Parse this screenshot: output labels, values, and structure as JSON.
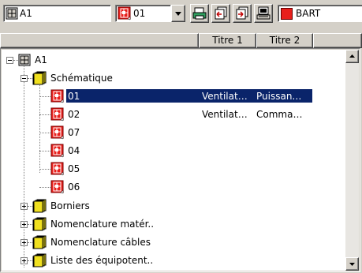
{
  "toolbar": {
    "project_field": {
      "value": "A1",
      "icon": "grid-frame-icon"
    },
    "sheet_field": {
      "value": "01",
      "icon": "red-schematic-sheet-icon"
    },
    "dropdown": {
      "icon": "chevron-down-icon"
    },
    "buttons": [
      {
        "name": "print-button",
        "icon": "printer-icon"
      },
      {
        "name": "previous-page-button",
        "icon": "page-back-icon"
      },
      {
        "name": "next-page-button",
        "icon": "page-forward-icon"
      },
      {
        "name": "computer-button",
        "icon": "computer-icon"
      }
    ],
    "extra_field": {
      "value": "BART",
      "icon": "red-square-icon"
    }
  },
  "columns": [
    {
      "label": ""
    },
    {
      "label": "Titre 1"
    },
    {
      "label": "Titre 2"
    },
    {
      "label": ""
    }
  ],
  "tree": {
    "root": {
      "label": "A1",
      "expanded": true,
      "icon": "grid-frame-icon"
    },
    "groups": [
      {
        "label": "Schématique",
        "expanded": true,
        "icon": "yellow-folder-stack-icon",
        "children": [
          {
            "label": "01",
            "titre1": "Ventilat…",
            "titre2": "Puissan…",
            "selected": true
          },
          {
            "label": "02",
            "titre1": "Ventilat…",
            "titre2": "Comma…",
            "selected": false
          },
          {
            "label": "07",
            "titre1": "",
            "titre2": "",
            "selected": false
          },
          {
            "label": "04",
            "titre1": "",
            "titre2": "",
            "selected": false
          },
          {
            "label": "05",
            "titre1": "",
            "titre2": "",
            "selected": false
          },
          {
            "label": "06",
            "titre1": "",
            "titre2": "",
            "selected": false
          }
        ]
      },
      {
        "label": "Borniers",
        "expanded": false,
        "icon": "yellow-folder-stack-icon"
      },
      {
        "label": "Nomenclature matér..",
        "expanded": false,
        "icon": "yellow-folder-stack-icon"
      },
      {
        "label": "Nomenclature câbles",
        "expanded": false,
        "icon": "yellow-folder-stack-icon"
      },
      {
        "label": "Liste des équipotent..",
        "expanded": false,
        "icon": "yellow-folder-stack-icon"
      }
    ]
  },
  "colors": {
    "selection": "#0a246a",
    "sheet_red": "#e8201c",
    "folder_yellow": "#f0e020",
    "face": "#d4d0c8"
  }
}
